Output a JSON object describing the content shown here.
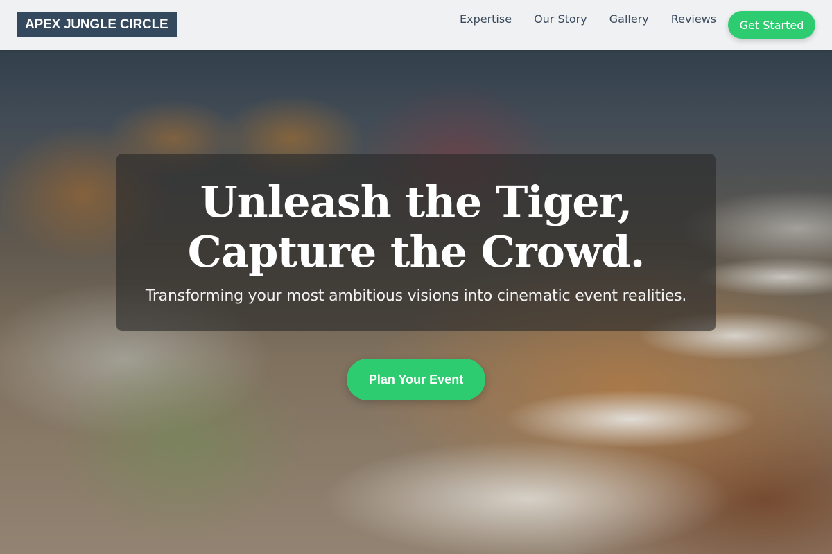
{
  "header": {
    "logo": "APEX JUNGLE CIRCLE",
    "nav": [
      {
        "label": "Expertise"
      },
      {
        "label": "Our Story"
      },
      {
        "label": "Gallery"
      },
      {
        "label": "Reviews"
      }
    ],
    "cta_label": "Get Started"
  },
  "hero": {
    "title_line1": "Unleash the Tiger,",
    "title_line2": "Capture the Crowd.",
    "subtitle": "Transforming your most ambitious visions into cinematic event realities.",
    "cta_label": "Plan Your Event"
  },
  "colors": {
    "logo_bg": "#34495e",
    "accent_green": "#2ecc71",
    "nav_text": "#3a4a5c"
  },
  "icons": []
}
